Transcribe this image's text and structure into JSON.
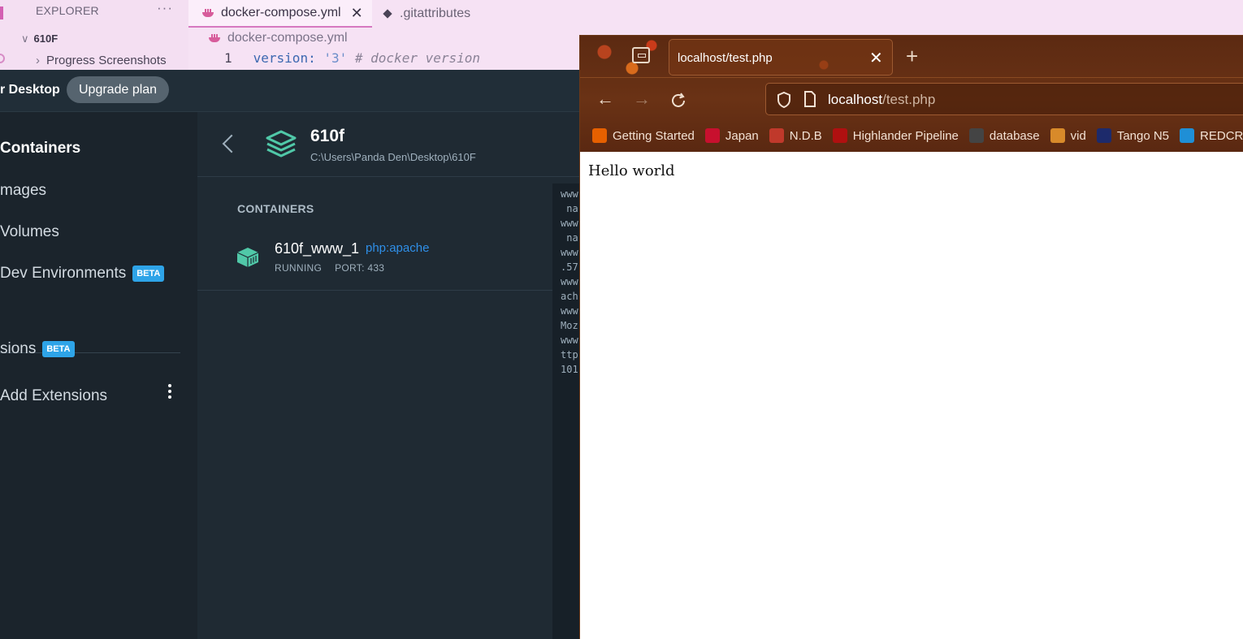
{
  "vscode": {
    "explorer_title": "EXPLORER",
    "more": "···",
    "folder": "610F",
    "subfolder": "Progress Screenshots",
    "tabs": [
      {
        "label": "docker-compose.yml",
        "close": "✕"
      },
      {
        "label": ".gitattributes"
      }
    ],
    "breadcrumb": "docker-compose.yml",
    "code_line": {
      "number": "1",
      "key": "version:",
      "value": "'3'",
      "comment": "# docker version"
    }
  },
  "docker": {
    "brand": "r Desktop",
    "upgrade_label": "Upgrade plan",
    "nav": {
      "containers": "Containers",
      "images": "mages",
      "volumes": "Volumes",
      "dev_env": "Dev Environments",
      "extensions": "sions",
      "add_extensions": "Add Extensions",
      "beta": "BETA"
    },
    "project": {
      "name": "610f",
      "path": "C:\\Users\\Panda Den\\Desktop\\610F"
    },
    "section_label": "CONTAINERS",
    "container": {
      "name": "610f_www_1",
      "image": "php:apache",
      "status": "RUNNING",
      "port": "PORT: 433"
    },
    "logs": [
      "www",
      " na",
      "www",
      " na",
      "www",
      ".57",
      "www",
      "ach",
      "www",
      "Moz",
      "www",
      "ttp",
      "101"
    ]
  },
  "firefox": {
    "tab_title": "localhost/test.php",
    "tab_close": "✕",
    "new_tab": "+",
    "url_host": "localhost",
    "url_path": "/test.php",
    "bookmarks": [
      {
        "label": "Getting Started",
        "color": "#e66000"
      },
      {
        "label": "Japan",
        "color": "#c8102e"
      },
      {
        "label": "N.D.B",
        "color": "#c0392b"
      },
      {
        "label": "Highlander Pipeline",
        "color": "#b01010"
      },
      {
        "label": "database",
        "color": "#444444"
      },
      {
        "label": "vid",
        "color": "#d88a2a"
      },
      {
        "label": "Tango N5",
        "color": "#1d2a6b"
      },
      {
        "label": "REDCR",
        "color": "#1f8fd6"
      }
    ],
    "page_text": "Hello world"
  },
  "colors": {
    "docker_accent": "#2ea4e8",
    "docker_teal": "#50c8a8",
    "firefox_theme": "#6a3215",
    "vscode_bg": "#f6e2f4"
  }
}
